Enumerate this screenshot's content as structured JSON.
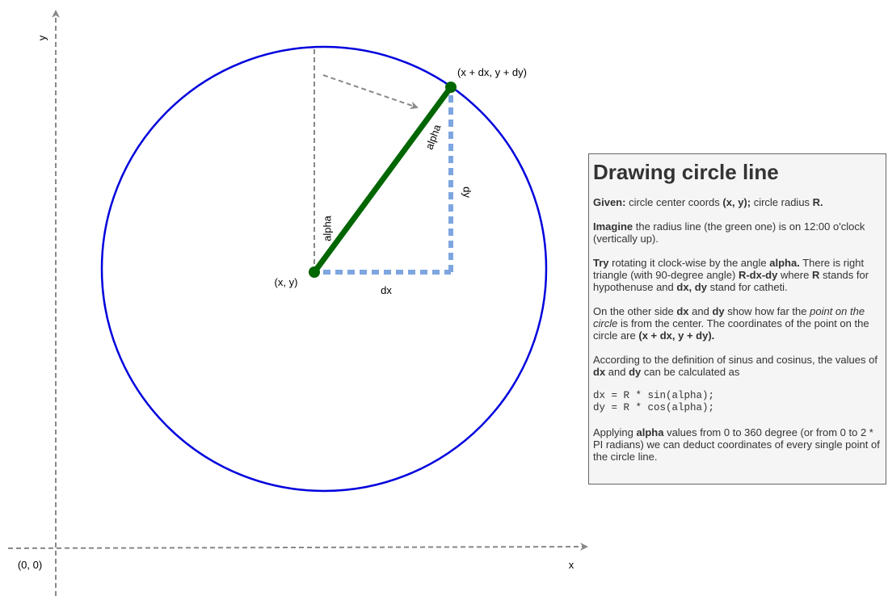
{
  "labels": {
    "y_axis": "y",
    "x_axis": "x",
    "origin": "(0, 0)",
    "center": "(x, y)",
    "circle_point": "(x + dx, y + dy)",
    "alpha_vertical": "alpha",
    "alpha_radius": "alpha",
    "dx": "dx",
    "dy": "dy"
  },
  "colors": {
    "axis": "#888888",
    "circle": "#0000dd",
    "radius": "#006600",
    "catheti": "#7ea6e0",
    "rotation_arrow": "#888888"
  },
  "info": {
    "title": "Drawing circle line",
    "p1_b1": "Given:",
    "p1_t1": " circle center coords ",
    "p1_b2": "(x, y);",
    "p1_t2": " circle radius ",
    "p1_b3": "R.",
    "p2_b1": "Imagine",
    "p2_t1": " the radius line (the green one) is on 12:00 o'clock (vertically up).",
    "p3_b1": "Try",
    "p3_t1": " rotating it clock-wise by the angle ",
    "p3_b2": "alpha.",
    "p3_t2": " There is right triangle (with 90-degree angle) ",
    "p3_b3": "R-dx-dy",
    "p3_t3": " where ",
    "p3_b4": "R",
    "p3_t4": " stands for hypothenuse and ",
    "p3_b5": "dx, dy",
    "p3_t5": " stand for catheti.",
    "p4_t1": "On the other side ",
    "p4_b1": "dx",
    "p4_t2": " and ",
    "p4_b2": "dy",
    "p4_t3": " show how far the ",
    "p4_i1": "point on the circle",
    "p4_t4": " is from the center. The coordinates of the point on the circle are ",
    "p4_b3": "(x + dx, y + dy).",
    "p5_t1": "According to the definition of sinus and cosinus, the values of ",
    "p5_b1": "dx",
    "p5_t2": " and ",
    "p5_b2": "dy",
    "p5_t3": " can be calculated as",
    "code": "dx = R * sin(alpha);\ndy = R * cos(alpha);",
    "p6_t1": "Applying ",
    "p6_b1": "alpha",
    "p6_t2": " values from 0 to 360 degree (or from 0 to 2 * PI radians) we can deduct coordinates of every single point of the circle line."
  }
}
